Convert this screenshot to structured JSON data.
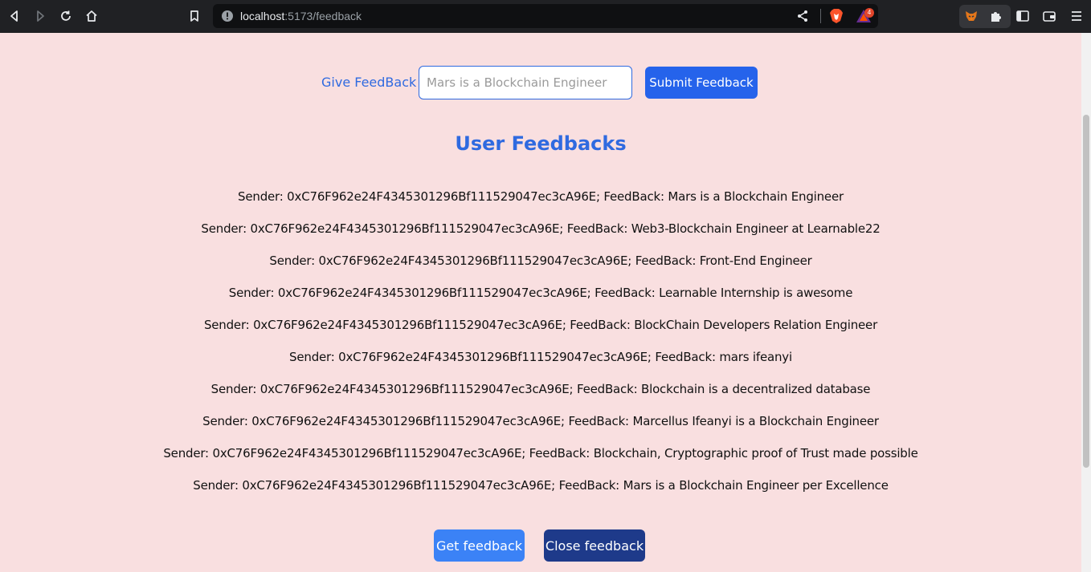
{
  "browser": {
    "url_host": "localhost",
    "url_rest": ":5173/feedback",
    "bat_badge": "4"
  },
  "form": {
    "label": "Give FeedBack",
    "input_placeholder": "Mars is a Blockchain Engineer",
    "input_value": "",
    "submit_label": "Submit Feedback"
  },
  "feedbacks": {
    "title": "User Feedbacks",
    "items": [
      "Sender: 0xC76F962e24F4345301296Bf111529047ec3cA96E; FeedBack: Mars is a Blockchain Engineer",
      "Sender: 0xC76F962e24F4345301296Bf111529047ec3cA96E; FeedBack: Web3-Blockchain Engineer at Learnable22",
      "Sender: 0xC76F962e24F4345301296Bf111529047ec3cA96E; FeedBack: Front-End Engineer",
      "Sender: 0xC76F962e24F4345301296Bf111529047ec3cA96E; FeedBack: Learnable Internship is awesome",
      "Sender: 0xC76F962e24F4345301296Bf111529047ec3cA96E; FeedBack: BlockChain Developers Relation Engineer",
      "Sender: 0xC76F962e24F4345301296Bf111529047ec3cA96E; FeedBack: mars ifeanyi",
      "Sender: 0xC76F962e24F4345301296Bf111529047ec3cA96E; FeedBack: Blockchain is a decentralized database",
      "Sender: 0xC76F962e24F4345301296Bf111529047ec3cA96E; FeedBack: Marcellus Ifeanyi is a Blockchain Engineer",
      "Sender: 0xC76F962e24F4345301296Bf111529047ec3cA96E; FeedBack: Blockchain, Cryptographic proof of Trust made possible",
      "Sender: 0xC76F962e24F4345301296Bf111529047ec3cA96E; FeedBack: Mars is a Blockchain Engineer per Excellence"
    ]
  },
  "actions": {
    "get_label": "Get feedback",
    "close_label": "Close feedback"
  },
  "colors": {
    "page_background": "#f9dfe0",
    "accent": "#2563eb",
    "accent_text": "#2f6ae0",
    "get_button": "#3b82f6",
    "close_button": "#1e3a8a"
  }
}
